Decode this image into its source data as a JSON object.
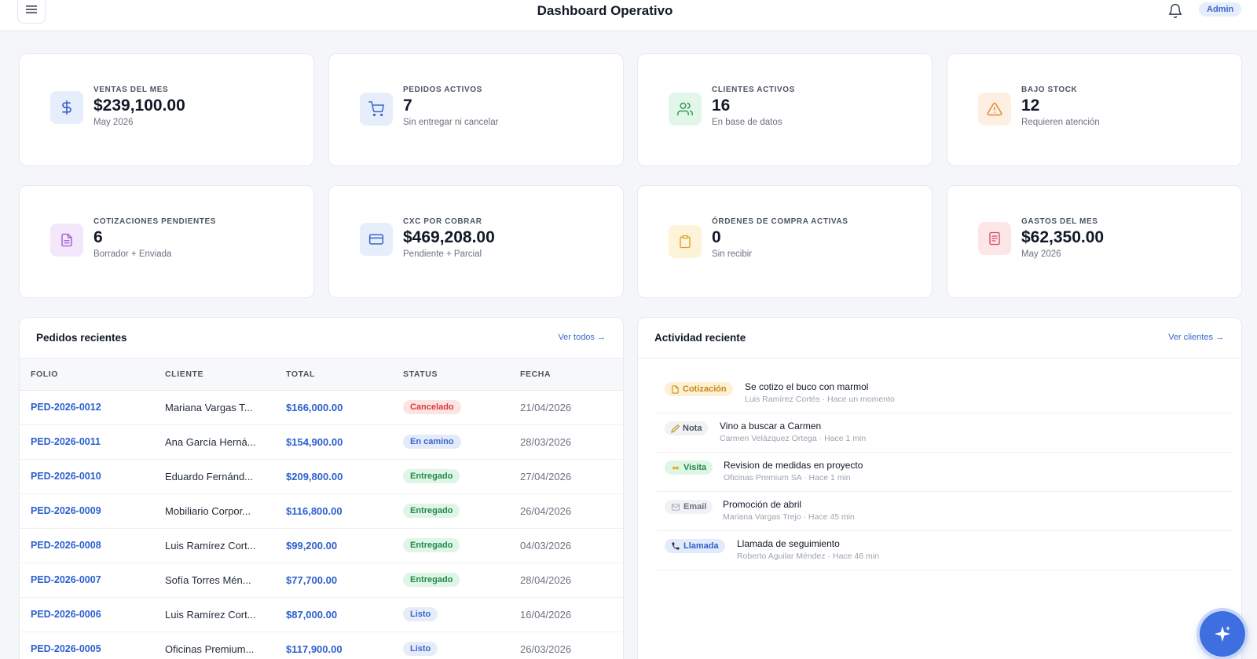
{
  "header": {
    "title": "Dashboard Operativo",
    "menu_icon": "hamburger-menu-icon",
    "bell_icon": "bell-icon",
    "user_badge": "Admin"
  },
  "stats": [
    {
      "label": "VENTAS DEL MES",
      "value": "$239,100.00",
      "sub": "May 2026",
      "icon": "dollar-icon",
      "bg": "#e6edfb",
      "color": "#3b66c9"
    },
    {
      "label": "PEDIDOS ACTIVOS",
      "value": "7",
      "sub": "Sin entregar ni cancelar",
      "icon": "cart-icon",
      "bg": "#e6edfb",
      "color": "#3b66c9"
    },
    {
      "label": "CLIENTES ACTIVOS",
      "value": "16",
      "sub": "En base de datos",
      "icon": "users-icon",
      "bg": "#e2f6ea",
      "color": "#2f9e5e"
    },
    {
      "label": "BAJO STOCK",
      "value": "12",
      "sub": "Requieren atención",
      "icon": "warning-icon",
      "bg": "#fdf0e2",
      "color": "#e08a2c"
    },
    {
      "label": "COTIZACIONES PENDIENTES",
      "value": "6",
      "sub": "Borrador + Enviada",
      "icon": "document-icon",
      "bg": "#f3e8fb",
      "color": "#9a55d0"
    },
    {
      "label": "CXC POR COBRAR",
      "value": "$469,208.00",
      "sub": "Pendiente + Parcial",
      "icon": "credit-card-icon",
      "bg": "#e6edfb",
      "color": "#3b66c9"
    },
    {
      "label": "ÓRDENES DE COMPRA ACTIVAS",
      "value": "0",
      "sub": "Sin recibir",
      "icon": "clipboard-icon",
      "bg": "#fdf3d8",
      "color": "#d9a21f"
    },
    {
      "label": "GASTOS DEL MES",
      "value": "$62,350.00",
      "sub": "May 2026",
      "icon": "receipt-icon",
      "bg": "#fde6e8",
      "color": "#d9485f"
    }
  ],
  "orders": {
    "title": "Pedidos recientes",
    "link": "Ver todos →",
    "columns": [
      "FOLIO",
      "CLIENTE",
      "TOTAL",
      "STATUS",
      "FECHA"
    ],
    "rows": [
      {
        "folio": "PED-2026-0012",
        "cliente": "Mariana Vargas T...",
        "total": "$166,000.00",
        "status": "Cancelado",
        "fecha": "21/04/2026"
      },
      {
        "folio": "PED-2026-0011",
        "cliente": "Ana García Herná...",
        "total": "$154,900.00",
        "status": "En camino",
        "fecha": "28/03/2026"
      },
      {
        "folio": "PED-2026-0010",
        "cliente": "Eduardo Fernánd...",
        "total": "$209,800.00",
        "status": "Entregado",
        "fecha": "27/04/2026"
      },
      {
        "folio": "PED-2026-0009",
        "cliente": "Mobiliario Corpor...",
        "total": "$116,800.00",
        "status": "Entregado",
        "fecha": "26/04/2026"
      },
      {
        "folio": "PED-2026-0008",
        "cliente": "Luis Ramírez Cort...",
        "total": "$99,200.00",
        "status": "Entregado",
        "fecha": "04/03/2026"
      },
      {
        "folio": "PED-2026-0007",
        "cliente": "Sofía Torres Mén...",
        "total": "$77,700.00",
        "status": "Entregado",
        "fecha": "28/04/2026"
      },
      {
        "folio": "PED-2026-0006",
        "cliente": "Luis Ramírez Cort...",
        "total": "$87,000.00",
        "status": "Listo",
        "fecha": "16/04/2026"
      },
      {
        "folio": "PED-2026-0005",
        "cliente": "Oficinas Premium...",
        "total": "$117,900.00",
        "status": "Listo",
        "fecha": "26/03/2026"
      }
    ],
    "status_colors": {
      "Cancelado": {
        "bg": "#fde4e4",
        "fg": "#d93a3a"
      },
      "En camino": {
        "bg": "#e3ebfb",
        "fg": "#3b66c9"
      },
      "Entregado": {
        "bg": "#dff5e6",
        "fg": "#238a4c"
      },
      "Listo": {
        "bg": "#e7ecf9",
        "fg": "#3b66c9"
      }
    }
  },
  "activity": {
    "title": "Actividad reciente",
    "link": "Ver clientes →",
    "items": [
      {
        "badge": "Cotización",
        "icon": "document-icon",
        "bg": "#fdf0d5",
        "fg": "#c58a12",
        "title": "Se cotizo el buco con marmol",
        "meta": "Luis Ramírez Cortés · Hace un momento"
      },
      {
        "badge": "Nota",
        "icon": "pencil-icon",
        "bg": "#f1f2f5",
        "fg": "#4b5563",
        "title": "Vino a buscar a Carmen",
        "meta": "Carmen Velázquez Ortega · Hace 1 min"
      },
      {
        "badge": "Visita",
        "icon": "handshake-icon",
        "bg": "#dff5e6",
        "fg": "#238a4c",
        "title": "Revision de medidas en proyecto",
        "meta": "Oficinas Premium SA · Hace 1 min"
      },
      {
        "badge": "Email",
        "icon": "envelope-icon",
        "bg": "#f1f2f5",
        "fg": "#6b7280",
        "title": "Promoción de abril",
        "meta": "Mariana Vargas Trejo · Hace 45 min"
      },
      {
        "badge": "Llamada",
        "icon": "phone-icon",
        "bg": "#e3ebfb",
        "fg": "#2c5fd0",
        "title": "Llamada de seguimiento",
        "meta": "Roberto Aguilar Méndez · Hace 46 min"
      }
    ]
  },
  "fab": {
    "icon": "sparkle-icon"
  }
}
